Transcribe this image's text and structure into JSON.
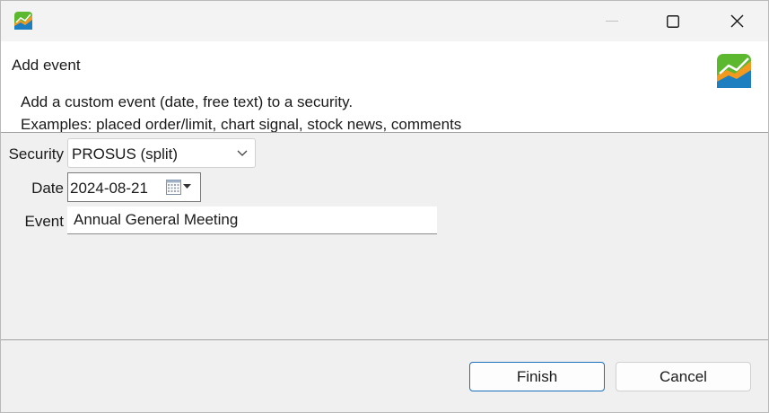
{
  "titlebar": {
    "app_icon": "portfolio-chart-icon",
    "controls": [
      "minimize-icon",
      "maximize-icon",
      "close-icon"
    ]
  },
  "header": {
    "title": "Add event",
    "description_line1": "Add a custom event (date, free text) to a security.",
    "description_line2": "Examples: placed order/limit, chart signal, stock news, comments",
    "logo": "portfolio-chart-icon"
  },
  "form": {
    "security_label": "Security",
    "security_value": "PROSUS (split)",
    "date_label": "Date",
    "date_value": "2024-08-21",
    "event_label": "Event",
    "event_value": "Annual General Meeting"
  },
  "buttons": {
    "finish": "Finish",
    "cancel": "Cancel"
  },
  "colors": {
    "accent": "#1c6fbd",
    "logo_green": "#5cb82e",
    "logo_orange": "#f29a1f",
    "logo_blue": "#1e7fc0"
  }
}
